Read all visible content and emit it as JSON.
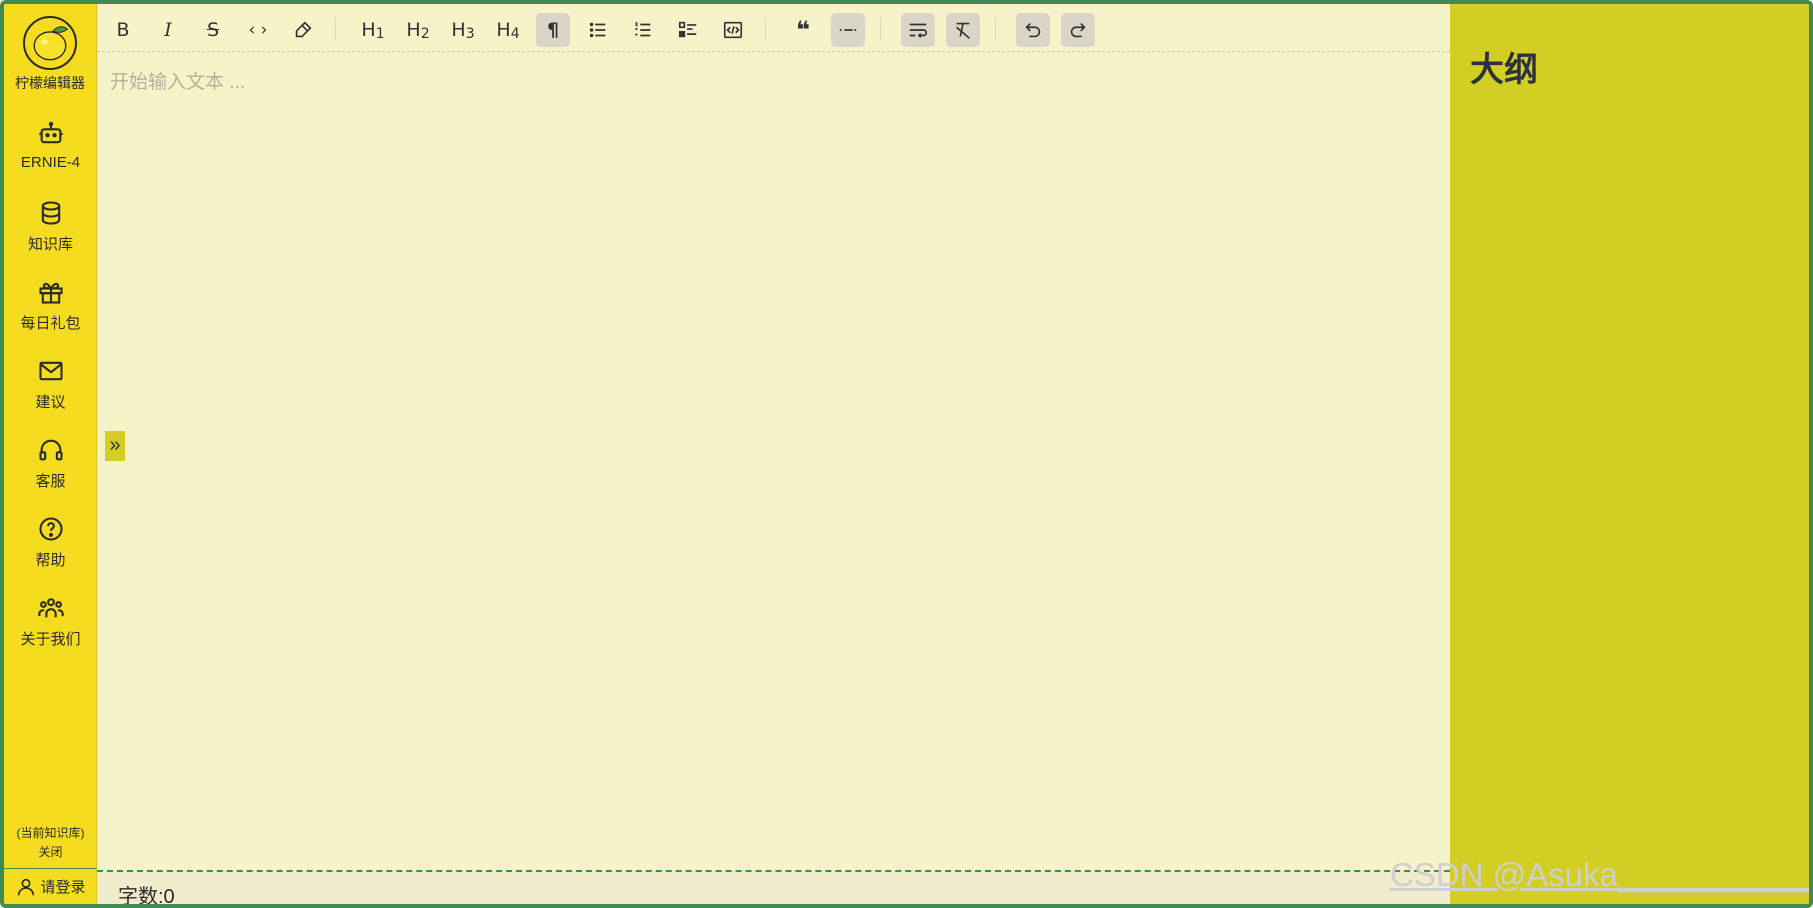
{
  "app": {
    "name": "柠檬编辑器",
    "logo_icon": "lemon-logo"
  },
  "sidebar": {
    "items": [
      {
        "label": "ERNIE-4",
        "icon": "robot-icon"
      },
      {
        "label": "知识库",
        "icon": "database-icon"
      },
      {
        "label": "每日礼包",
        "icon": "gift-icon"
      },
      {
        "label": "建议",
        "icon": "mail-icon"
      },
      {
        "label": "客服",
        "icon": "headset-icon"
      },
      {
        "label": "帮助",
        "icon": "help-circle-icon"
      },
      {
        "label": "关于我们",
        "icon": "team-icon"
      }
    ],
    "kb_status_line1": "(当前知识库)",
    "kb_status_line2": "关闭",
    "login_label": "请登录"
  },
  "toolbar": {
    "bold": "B",
    "italic": "I",
    "strike": "S",
    "code": "‹ ›",
    "h1": "H",
    "h1_sub": "1",
    "h2": "H",
    "h2_sub": "2",
    "h3": "H",
    "h3_sub": "3",
    "h4": "H",
    "h4_sub": "4",
    "paragraph": "¶",
    "quote": "❝"
  },
  "editor": {
    "placeholder": "开始输入文本 ...",
    "expand_toggle": "»"
  },
  "outline": {
    "title": "大纲"
  },
  "footer": {
    "word_count": "字数:0"
  },
  "watermark": "CSDN @Asuka____________",
  "colors": {
    "sidebar_bg": "#f6dc1e",
    "editor_bg": "#f7f3c9",
    "outline_bg": "#d3ce23",
    "frame_border": "#3f8a55"
  }
}
